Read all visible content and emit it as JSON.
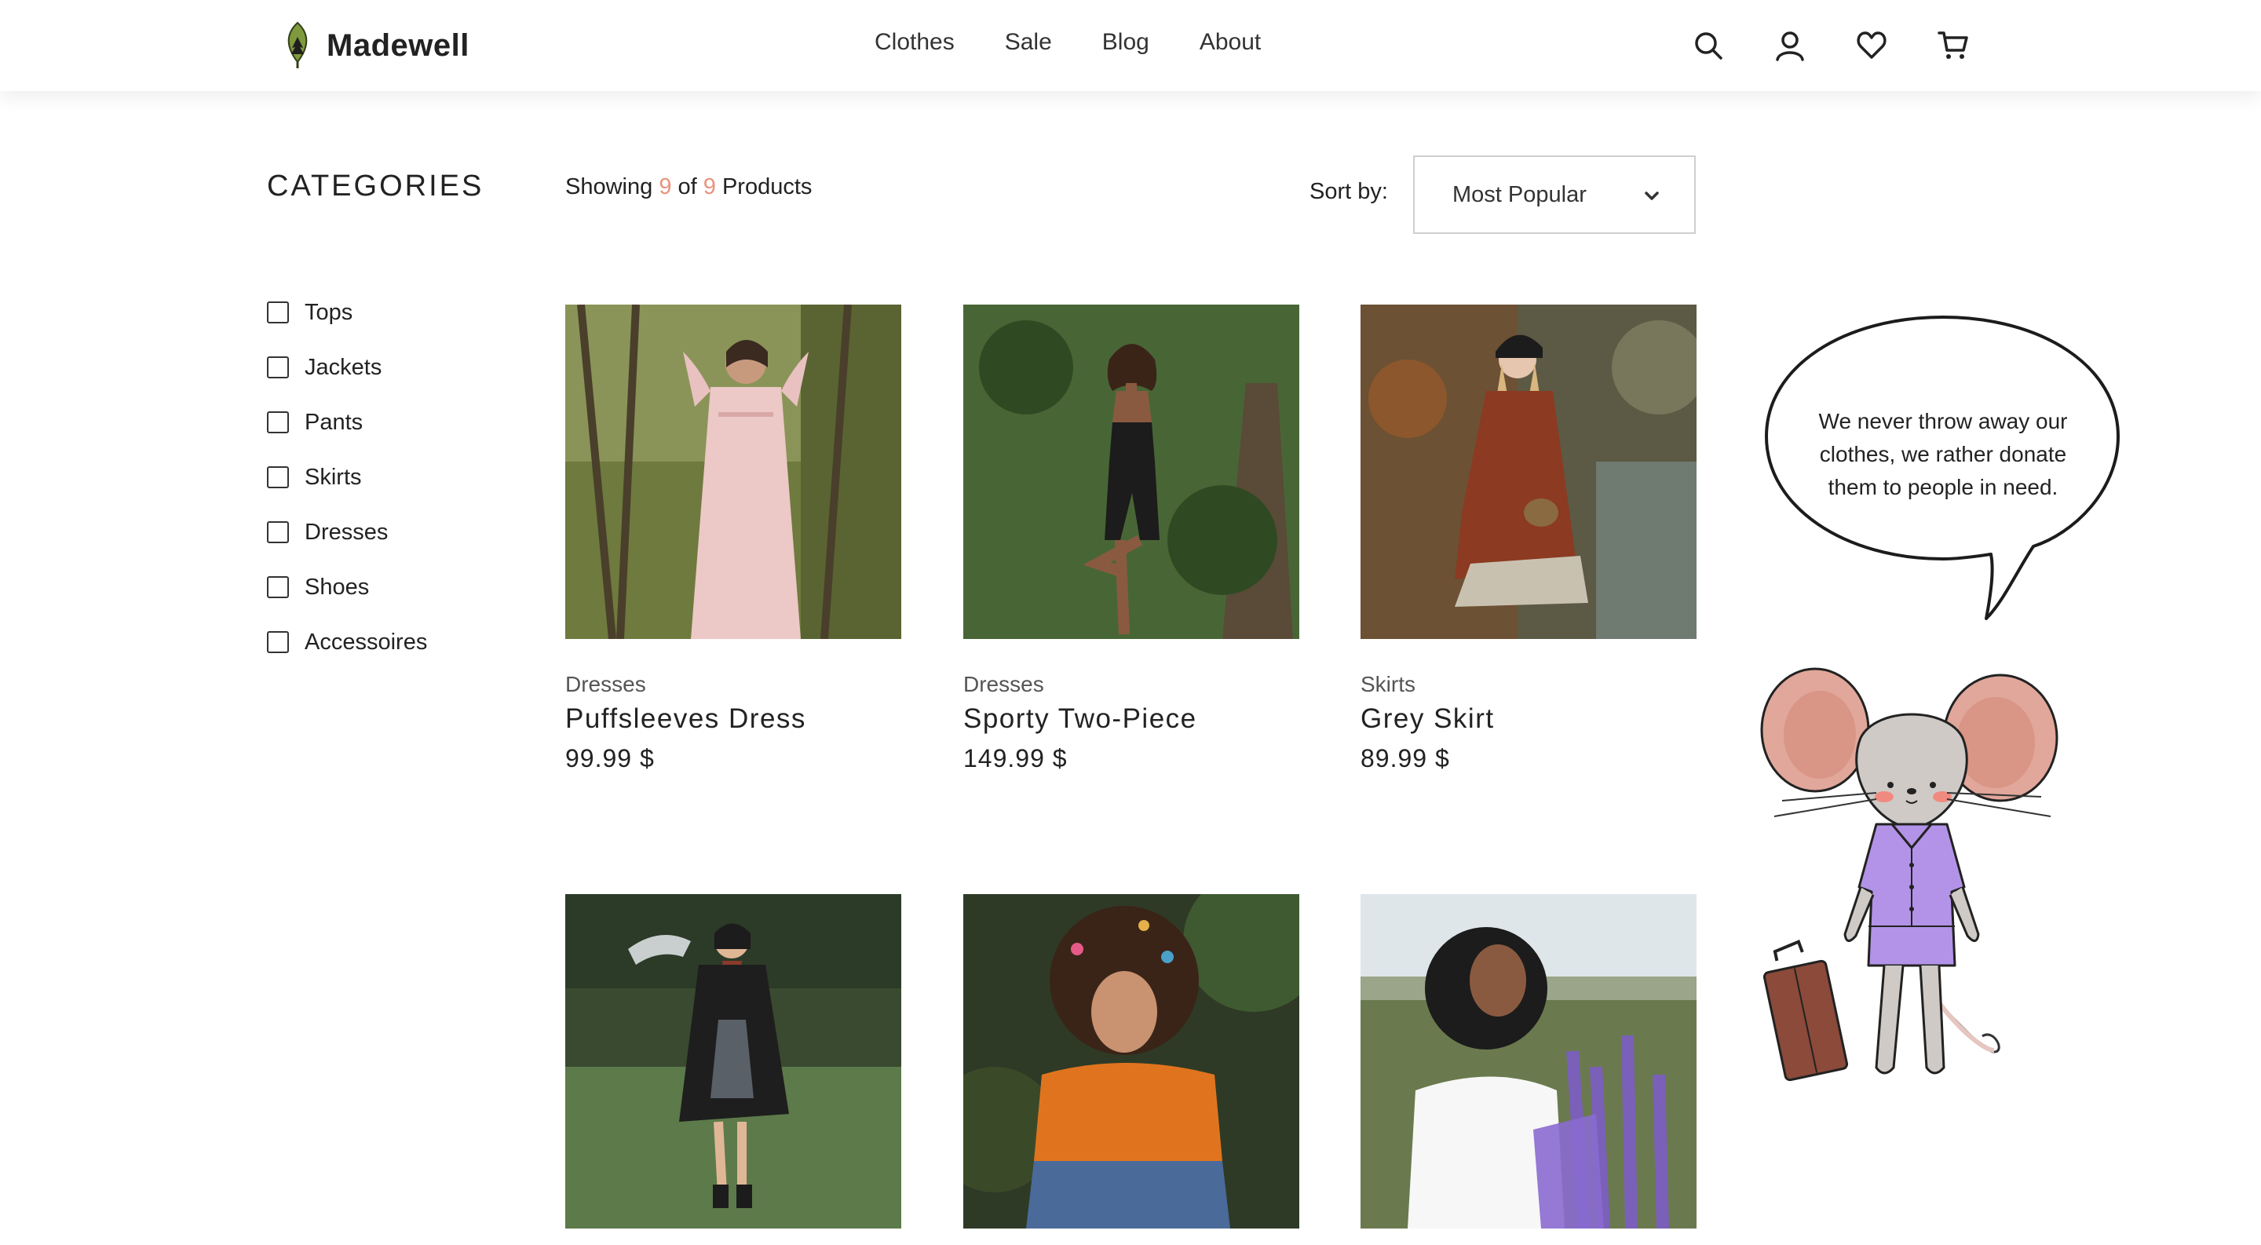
{
  "brand": {
    "name": "Madewell",
    "logo_icon": "leaf-logo-icon"
  },
  "nav": [
    "Clothes",
    "Sale",
    "Blog",
    "About"
  ],
  "header_icons": [
    "search-icon",
    "user-icon",
    "heart-icon",
    "cart-icon"
  ],
  "sidebar": {
    "title": "CATEGORIES",
    "categories": [
      "Tops",
      "Jackets",
      "Pants",
      "Skirts",
      "Dresses",
      "Shoes",
      "Accessoires"
    ]
  },
  "toolbar": {
    "showing_prefix": "Showing",
    "shown_count": "9",
    "of_word": "of",
    "total_count": "9",
    "showing_suffix": "Products",
    "sort_label": "Sort by:",
    "sort_value": "Most Popular"
  },
  "products": [
    {
      "category": "Dresses",
      "name": "Puffsleeves Dress",
      "price": "99.99 $"
    },
    {
      "category": "Dresses",
      "name": "Sporty Two-Piece",
      "price": "149.99 $"
    },
    {
      "category": "Skirts",
      "name": "Grey Skirt",
      "price": "89.99 $"
    },
    {
      "category": "",
      "name": "",
      "price": ""
    },
    {
      "category": "",
      "name": "",
      "price": ""
    },
    {
      "category": "",
      "name": "",
      "price": ""
    }
  ],
  "speech_bubble": {
    "text": "We never throw away our clothes, we rather donate them to people in need."
  },
  "colors": {
    "accent": "#e8937e",
    "dress_purple": "#b393e8",
    "ear_pink": "#e0a79a",
    "suitcase": "#8b4a3a"
  }
}
